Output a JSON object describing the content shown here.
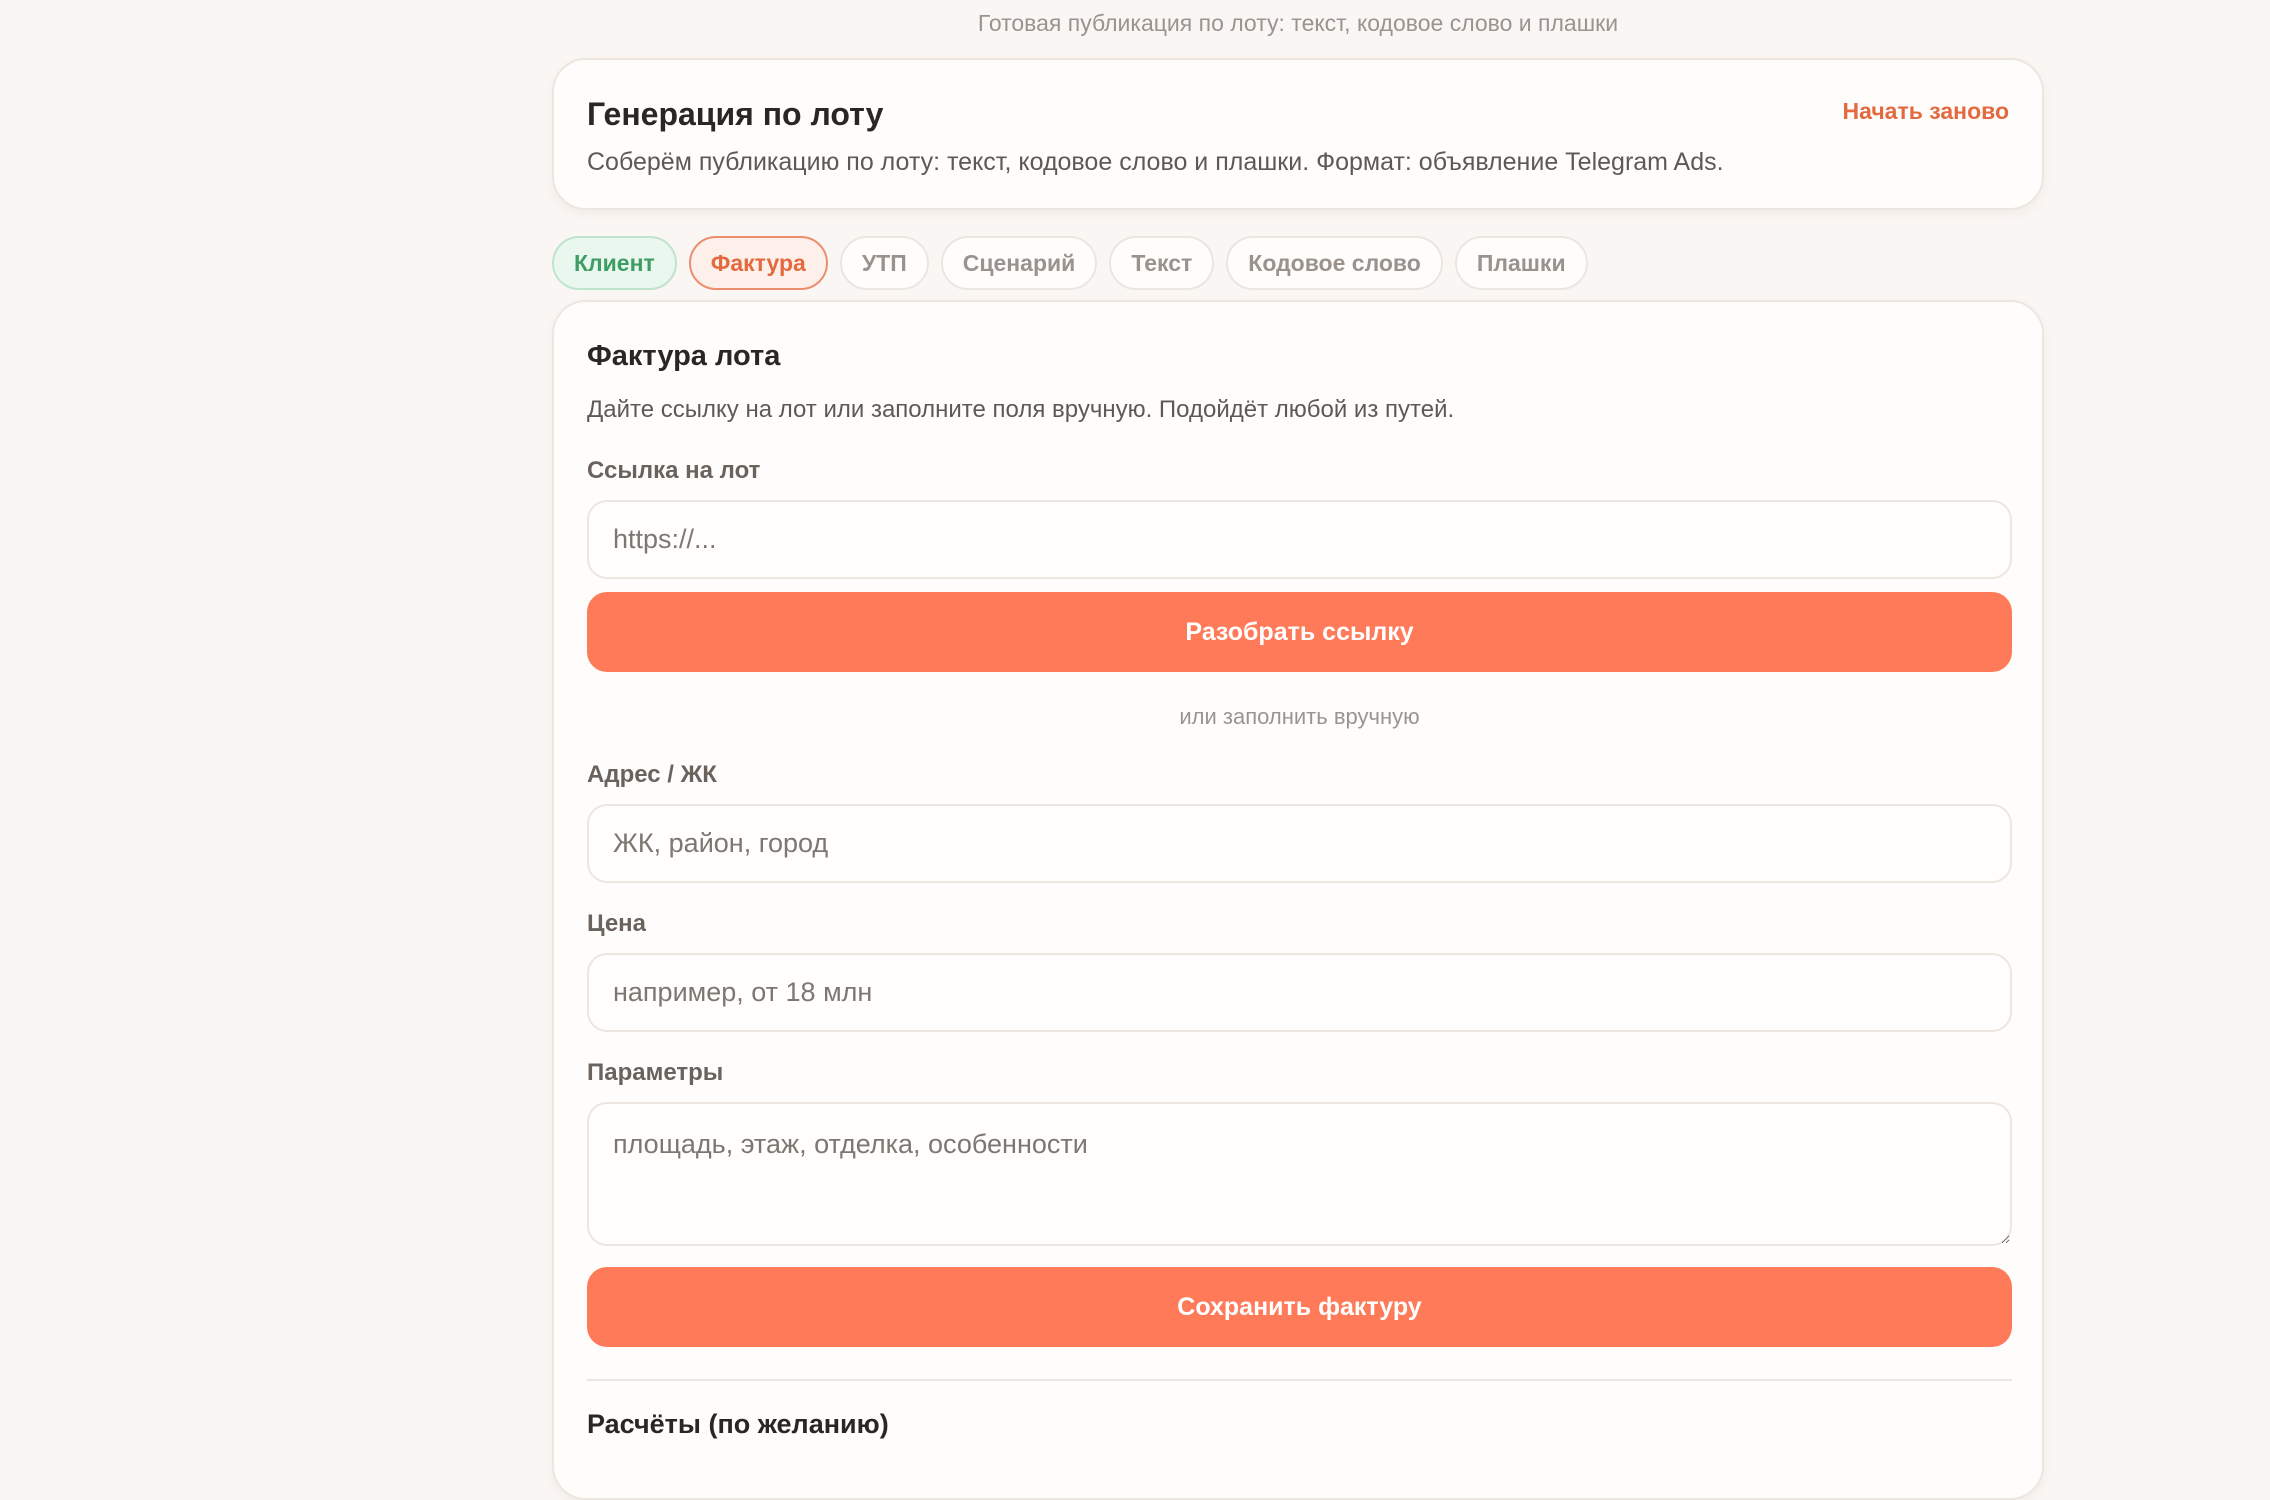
{
  "top_caption": "Готовая публикация по лоту: текст, кодовое слово и плашки",
  "header": {
    "title": "Генерация по лоту",
    "restart_label": "Начать заново",
    "description": "Соберём публикацию по лоту: текст, кодовое слово и плашки. Формат: объявление Telegram Ads."
  },
  "tabs": [
    {
      "label": "Клиент",
      "state": "done"
    },
    {
      "label": "Фактура",
      "state": "active"
    },
    {
      "label": "УТП",
      "state": "pending"
    },
    {
      "label": "Сценарий",
      "state": "pending"
    },
    {
      "label": "Текст",
      "state": "pending"
    },
    {
      "label": "Кодовое слово",
      "state": "pending"
    },
    {
      "label": "Плашки",
      "state": "pending"
    }
  ],
  "section": {
    "title": "Фактура лота",
    "description": "Дайте ссылку на лот или заполните поля вручную. Подойдёт любой из путей.",
    "link": {
      "label": "Ссылка на лот",
      "placeholder": "https://...",
      "value": ""
    },
    "parse_button": "Разобрать ссылку",
    "or_manual": "или заполнить вручную",
    "address": {
      "label": "Адрес / ЖК",
      "placeholder": "ЖК, район, город",
      "value": ""
    },
    "price": {
      "label": "Цена",
      "placeholder": "например, от 18 млн",
      "value": ""
    },
    "params": {
      "label": "Параметры",
      "placeholder": "площадь, этаж, отделка, особенности",
      "value": ""
    },
    "save_button": "Сохранить фактуру",
    "calculations_title": "Расчёты (по желанию)"
  },
  "colors": {
    "accent": "#ff7a59",
    "accent_text": "#e4693f",
    "done_green": "#3d9d63",
    "background": "#faf6f3"
  }
}
